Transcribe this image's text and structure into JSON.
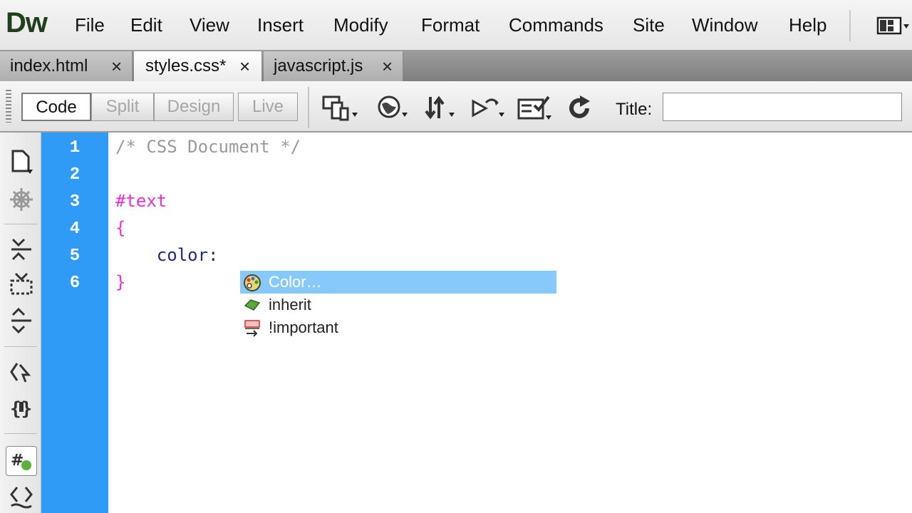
{
  "app": {
    "logo": "Dw"
  },
  "menu": [
    "File",
    "Edit",
    "View",
    "Insert",
    "Modify",
    "Format",
    "Commands",
    "Site",
    "Window",
    "Help"
  ],
  "tabs": [
    {
      "label": "index.html",
      "close": "×",
      "active": false
    },
    {
      "label": "styles.css*",
      "close": "×",
      "active": true
    },
    {
      "label": "javascript.js",
      "close": "×",
      "active": false
    }
  ],
  "toolbar": {
    "views": [
      "Code",
      "Split",
      "Design",
      "Live"
    ],
    "active_view": "Code",
    "icons": [
      "multiscreen-icon",
      "preview-browser-icon",
      "file-transfer-icon",
      "debug-icon",
      "visual-aids-icon",
      "refresh-icon"
    ],
    "title_label": "Title:",
    "title_value": ""
  },
  "left_tools": [
    "open-documents-icon",
    "show-code-navigator-icon",
    "collapse-full-tag-icon",
    "collapse-selection-icon",
    "expand-all-icon",
    "select-parent-tag-icon",
    "balance-braces-icon",
    "syntax-coloring-icon",
    "wrap-tag-icon"
  ],
  "editor": {
    "line_numbers": [
      "1",
      "2",
      "3",
      "4",
      "5",
      "6"
    ],
    "lines": [
      {
        "text": "/* CSS Document */",
        "kind": "comment"
      },
      {
        "text": "",
        "kind": "blank"
      },
      {
        "text": "#text",
        "kind": "selector"
      },
      {
        "text": "{",
        "kind": "brace"
      },
      {
        "text": "    color:",
        "kind": "property"
      },
      {
        "text": "}",
        "kind": "brace"
      }
    ]
  },
  "code_hint": {
    "items": [
      {
        "label": "Color…",
        "icon": "color-picker-icon",
        "selected": true
      },
      {
        "label": "inherit",
        "icon": "value-icon",
        "selected": false
      },
      {
        "label": "!important",
        "icon": "important-icon",
        "selected": false
      }
    ]
  },
  "colors": {
    "gutter": "#2f9bf6",
    "comment": "#9a9a9a",
    "selector": "#ee2ed8",
    "property": "#202a7a",
    "hint_selected": "#87c9fb"
  }
}
